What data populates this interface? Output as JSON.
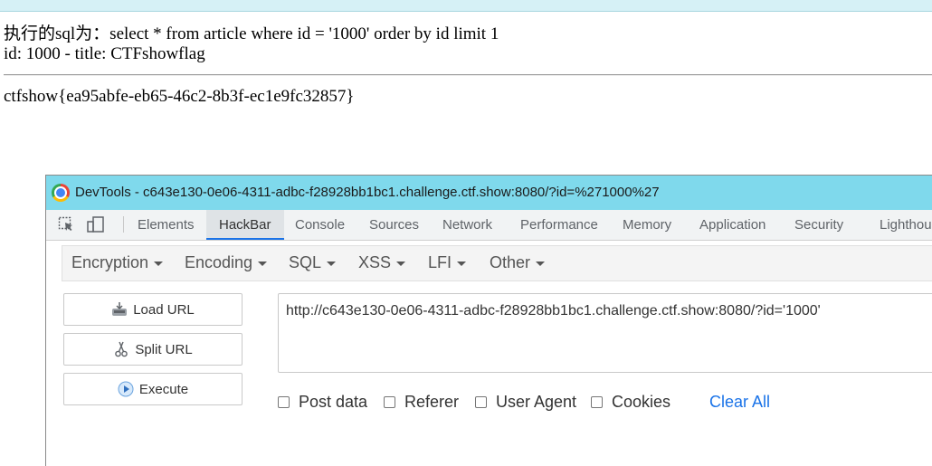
{
  "page": {
    "sql_line": "执行的sql为：select * from article where id = '1000' order by id limit 1",
    "result_line": "id: 1000 - title: CTFshowflag",
    "flag": "ctfshow{ea95abfe-eb65-46c2-8b3f-ec1e9fc32857}"
  },
  "devtools": {
    "title": "DevTools - c643e130-0e06-4311-adbc-f28928bb1bc1.challenge.ctf.show:8080/?id=%271000%27",
    "tabs": [
      "Elements",
      "HackBar",
      "Console",
      "Sources",
      "Network",
      "Performance",
      "Memory",
      "Application",
      "Security",
      "Lighthouse"
    ],
    "active_tab": "HackBar"
  },
  "hackbar": {
    "menus": [
      "Encryption",
      "Encoding",
      "SQL",
      "XSS",
      "LFI",
      "Other"
    ],
    "buttons": {
      "load": "Load URL",
      "split": "Split URL",
      "execute": "Execute"
    },
    "url_value": "http://c643e130-0e06-4311-adbc-f28928bb1bc1.challenge.ctf.show:8080/?id='1000'",
    "options": [
      "Post data",
      "Referer",
      "User Agent",
      "Cookies"
    ],
    "clear_all": "Clear All"
  }
}
